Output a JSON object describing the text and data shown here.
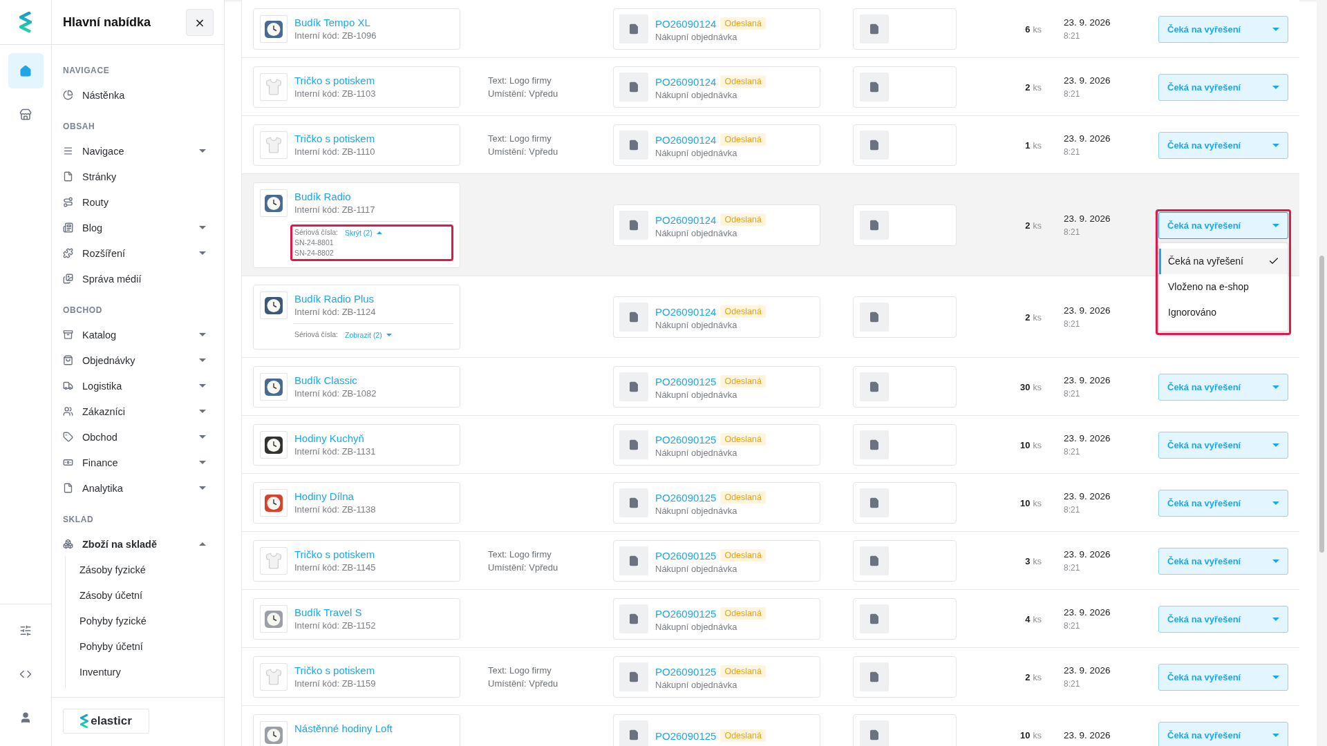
{
  "rail": {
    "top": [
      {
        "selected": true
      },
      {
        "selected": false
      }
    ],
    "bottom": [
      {
        "selected": false
      },
      {
        "selected": false
      },
      {
        "selected": false
      }
    ]
  },
  "menu": {
    "title": "Hlavní nabídka",
    "close": "×",
    "sections": [
      {
        "heading": "NAVIGACE",
        "items": [
          {
            "label": "Nástěnka"
          }
        ]
      },
      {
        "heading": "OBSAH",
        "items": [
          {
            "label": "Navigace",
            "expanded": false
          },
          {
            "label": "Stránky"
          },
          {
            "label": "Routy"
          },
          {
            "label": "Blog",
            "expanded": false
          },
          {
            "label": "Rozšíření",
            "expanded": false
          },
          {
            "label": "Správa médií"
          }
        ]
      },
      {
        "heading": "OBCHOD",
        "items": [
          {
            "label": "Katalog",
            "expanded": false
          },
          {
            "label": "Objednávky",
            "expanded": false
          },
          {
            "label": "Logistika",
            "expanded": false
          },
          {
            "label": "Zákazníci",
            "expanded": false
          },
          {
            "label": "Obchod",
            "expanded": false
          },
          {
            "label": "Finance",
            "expanded": false
          },
          {
            "label": "Analytika",
            "expanded": false
          }
        ]
      },
      {
        "heading": "SKLAD",
        "items": [
          {
            "label": "Zboží na skladě",
            "expanded": true,
            "children": [
              {
                "label": "Zásoby fyzické"
              },
              {
                "label": "Zásoby účetní"
              },
              {
                "label": "Pohyby fyzické"
              },
              {
                "label": "Pohyby účetní"
              },
              {
                "label": "Inventury"
              }
            ]
          }
        ]
      }
    ],
    "brand": "elasticr"
  },
  "rows": [
    {
      "hovered": false,
      "product": {
        "name": "Budík Tempo XL",
        "code": "Interní kód: ZB-1096",
        "thumb": {
          "kind": "clock",
          "color": "#4a6a94"
        }
      },
      "order": {
        "number": "PO26090124",
        "badge": "Odeslaná",
        "type": "Nákupní objednávka"
      },
      "qty": "6",
      "unit": "ks",
      "date": "23. 9. 2026",
      "time": "8:21",
      "status": {
        "label": "Čeká na vyřešení",
        "open": false
      }
    },
    {
      "hovered": false,
      "product": {
        "name": "Tričko s potiskem",
        "code": "Interní kód: ZB-1103",
        "thumb": {
          "kind": "tshirt"
        }
      },
      "attributes": [
        "Text: Logo firmy",
        "Umístění: Vpředu"
      ],
      "order": {
        "number": "PO26090124",
        "badge": "Odeslaná",
        "type": "Nákupní objednávka"
      },
      "qty": "2",
      "unit": "ks",
      "date": "23. 9. 2026",
      "time": "8:21",
      "status": {
        "label": "Čeká na vyřešení",
        "open": false
      }
    },
    {
      "hovered": false,
      "product": {
        "name": "Tričko s potiskem",
        "code": "Interní kód: ZB-1110",
        "thumb": {
          "kind": "tshirt"
        }
      },
      "attributes": [
        "Text: Logo firmy",
        "Umístění: Vpředu"
      ],
      "order": {
        "number": "PO26090124",
        "badge": "Odeslaná",
        "type": "Nákupní objednávka"
      },
      "qty": "1",
      "unit": "ks",
      "date": "23. 9. 2026",
      "time": "8:21",
      "status": {
        "label": "Čeká na vyřešení",
        "open": false
      }
    },
    {
      "hovered": true,
      "product": {
        "name": "Budík Radio",
        "code": "Interní kód: ZB-1117",
        "thumb": {
          "kind": "clock",
          "color": "#4a6a94"
        },
        "serials": {
          "label": "Sériová čísla:",
          "toggle": "Skrýt (2)",
          "expanded": true,
          "highlighted": true,
          "items": [
            "SN-24-8801",
            "SN-24-8802"
          ]
        }
      },
      "order": {
        "number": "PO26090124",
        "badge": "Odeslaná",
        "type": "Nákupní objednávka"
      },
      "qty": "2",
      "unit": "ks",
      "date": "23. 9. 2026",
      "time": "8:21",
      "status": {
        "label": "Čeká na vyřešení",
        "open": true,
        "highlighted": true,
        "options": [
          {
            "label": "Čeká na vyřešení",
            "selected": true
          },
          {
            "label": "Vloženo na e-shop",
            "selected": false
          },
          {
            "label": "Ignorováno",
            "selected": false
          }
        ]
      }
    },
    {
      "hovered": false,
      "product": {
        "name": "Budík Radio Plus",
        "code": "Interní kód: ZB-1124",
        "thumb": {
          "kind": "clock",
          "color": "#3d5878"
        },
        "serials": {
          "label": "Sériová čísla:",
          "toggle": "Zobrazit (2)",
          "expanded": false,
          "highlighted": false
        }
      },
      "order": {
        "number": "PO26090124",
        "badge": "Odeslaná",
        "type": "Nákupní objednávka"
      },
      "qty": "2",
      "unit": "ks",
      "date": "23. 9. 2026",
      "time": "8:21"
    },
    {
      "hovered": false,
      "product": {
        "name": "Budík Classic",
        "code": "Interní kód: ZB-1082",
        "thumb": {
          "kind": "clock",
          "color": "#4a6a94"
        }
      },
      "order": {
        "number": "PO26090125",
        "badge": "Odeslaná",
        "type": "Nákupní objednávka"
      },
      "qty": "30",
      "unit": "ks",
      "date": "23. 9. 2026",
      "time": "8:21",
      "status": {
        "label": "Čeká na vyřešení",
        "open": false
      }
    },
    {
      "hovered": false,
      "product": {
        "name": "Hodiny Kuchyň",
        "code": "Interní kód: ZB-1131",
        "thumb": {
          "kind": "clock",
          "color": "#333333"
        }
      },
      "order": {
        "number": "PO26090125",
        "badge": "Odeslaná",
        "type": "Nákupní objednávka"
      },
      "qty": "10",
      "unit": "ks",
      "date": "23. 9. 2026",
      "time": "8:21",
      "status": {
        "label": "Čeká na vyřešení",
        "open": false
      }
    },
    {
      "hovered": false,
      "product": {
        "name": "Hodiny Dílna",
        "code": "Interní kód: ZB-1138",
        "thumb": {
          "kind": "clock",
          "color": "#d9412b"
        }
      },
      "order": {
        "number": "PO26090125",
        "badge": "Odeslaná",
        "type": "Nákupní objednávka"
      },
      "qty": "10",
      "unit": "ks",
      "date": "23. 9. 2026",
      "time": "8:21",
      "status": {
        "label": "Čeká na vyřešení",
        "open": false
      }
    },
    {
      "hovered": false,
      "product": {
        "name": "Tričko s potiskem",
        "code": "Interní kód: ZB-1145",
        "thumb": {
          "kind": "tshirt"
        }
      },
      "attributes": [
        "Text: Logo firmy",
        "Umístění: Vpředu"
      ],
      "order": {
        "number": "PO26090125",
        "badge": "Odeslaná",
        "type": "Nákupní objednávka"
      },
      "qty": "3",
      "unit": "ks",
      "date": "23. 9. 2026",
      "time": "8:21",
      "status": {
        "label": "Čeká na vyřešení",
        "open": false
      }
    },
    {
      "hovered": false,
      "product": {
        "name": "Budík Travel S",
        "code": "Interní kód: ZB-1152",
        "thumb": {
          "kind": "clock",
          "color": "#9aa0a6"
        }
      },
      "order": {
        "number": "PO26090125",
        "badge": "Odeslaná",
        "type": "Nákupní objednávka"
      },
      "qty": "4",
      "unit": "ks",
      "date": "23. 9. 2026",
      "time": "8:21",
      "status": {
        "label": "Čeká na vyřešení",
        "open": false
      }
    },
    {
      "hovered": false,
      "product": {
        "name": "Tričko s potiskem",
        "code": "Interní kód: ZB-1159",
        "thumb": {
          "kind": "tshirt"
        }
      },
      "attributes": [
        "Text: Logo firmy",
        "Umístění: Vpředu"
      ],
      "order": {
        "number": "PO26090125",
        "badge": "Odeslaná",
        "type": "Nákupní objednávka"
      },
      "qty": "2",
      "unit": "ks",
      "date": "23. 9. 2026",
      "time": "8:21",
      "status": {
        "label": "Čeká na vyřešení",
        "open": false
      }
    },
    {
      "hovered": false,
      "product": {
        "name": "Nástěnné hodiny Loft",
        "thumb": {
          "kind": "clock",
          "color": "#9aa0a6"
        }
      },
      "order": {
        "number": "PO26090125",
        "badge": "Odeslaná"
      },
      "qty": "10",
      "unit": "ks",
      "date": "23. 9. 2026",
      "status": {
        "label": "Čeká na vyřešení",
        "open": false
      }
    }
  ]
}
